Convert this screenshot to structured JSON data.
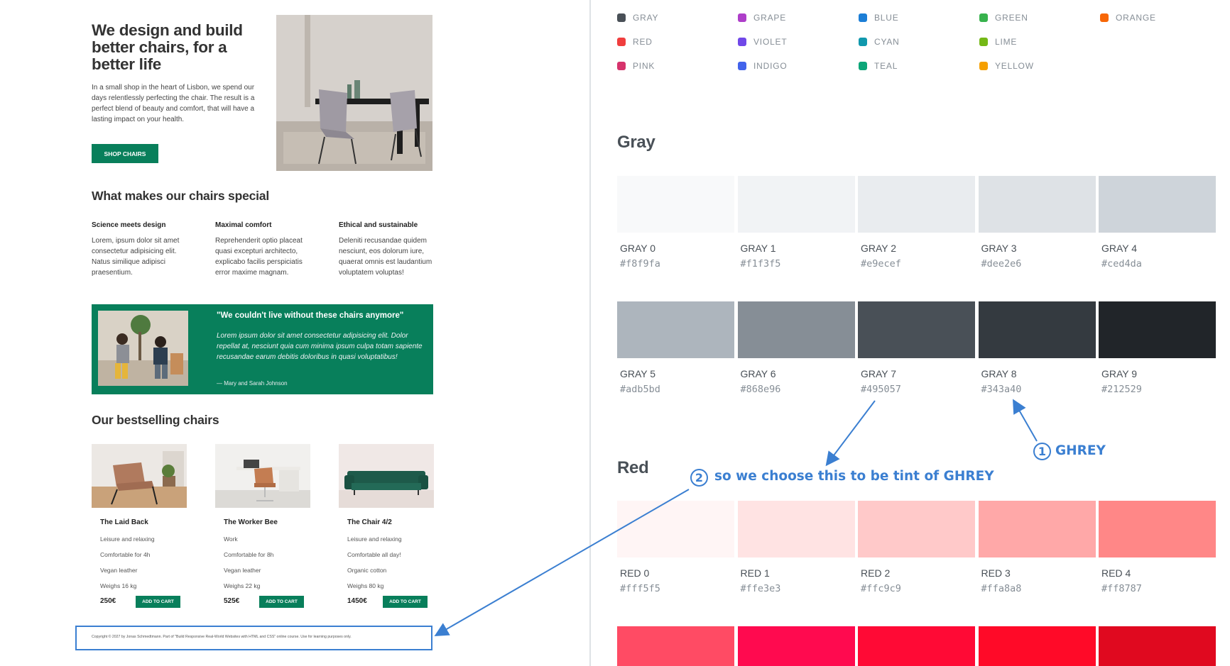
{
  "hero": {
    "title": "We design and build better chairs, for a better life",
    "text": "In a small shop in the heart of Lisbon, we spend our days relentlessly perfecting the chair. The result is a perfect blend of beauty and comfort, that will have a lasting impact on your health.",
    "button": "SHOP CHAIRS"
  },
  "features": {
    "title": "What makes our chairs special",
    "items": [
      {
        "title": "Science meets design",
        "text": "Lorem, ipsum dolor sit amet consectetur adipisicing elit. Natus similique adipisci praesentium."
      },
      {
        "title": "Maximal comfort",
        "text": "Reprehenderit optio placeat quasi excepturi architecto, explicabo facilis perspiciatis error maxime magnam."
      },
      {
        "title": "Ethical and sustainable",
        "text": "Deleniti recusandae quidem nesciunt, eos dolorum iure, quaerat omnis est laudantium voluptatem voluptas!"
      }
    ]
  },
  "testimonial": {
    "quote": "\"We couldn't live without these chairs anymore\"",
    "text": "Lorem ipsum dolor sit amet consectetur adipisicing elit. Dolor repellat at, nesciunt quia cum minima ipsum culpa totam sapiente recusandae earum debitis doloribus in quasi voluptatibus!",
    "author": "— Mary and Sarah Johnson"
  },
  "products": {
    "title": "Our bestselling chairs",
    "items": [
      {
        "name": "The Laid Back",
        "f1": "Leisure and relaxing",
        "f2": "Comfortable for 4h",
        "f3": "Vegan leather",
        "f4": "Weighs 16 kg",
        "price": "250€",
        "cart": "ADD TO CART"
      },
      {
        "name": "The Worker Bee",
        "f1": "Work",
        "f2": "Comfortable for 8h",
        "f3": "Vegan leather",
        "f4": "Weighs 22 kg",
        "price": "525€",
        "cart": "ADD TO CART"
      },
      {
        "name": "The Chair 4/2",
        "f1": "Leisure and relaxing",
        "f2": "Comfortable all day!",
        "f3": "Organic cotton",
        "f4": "Weighs 80 kg",
        "price": "1450€",
        "cart": "ADD TO CART"
      }
    ]
  },
  "footer": "Copyright © 2027 by Jonas Schmedtmann. Part of \"Build Responsive Real-World Websites with HTML and CSS\" online course. Use for learning purposes only.",
  "legend": [
    {
      "label": "GRAY",
      "color": "#495057"
    },
    {
      "label": "GRAPE",
      "color": "#ae3ec9"
    },
    {
      "label": "BLUE",
      "color": "#1c7ed6"
    },
    {
      "label": "GREEN",
      "color": "#37b24d"
    },
    {
      "label": "ORANGE",
      "color": "#f76707"
    },
    {
      "label": "RED",
      "color": "#f03e3e"
    },
    {
      "label": "VIOLET",
      "color": "#7048e8"
    },
    {
      "label": "CYAN",
      "color": "#1098ad"
    },
    {
      "label": "LIME",
      "color": "#74b816"
    },
    {
      "label": "PINK",
      "color": "#d6336c"
    },
    {
      "label": "INDIGO",
      "color": "#4263eb"
    },
    {
      "label": "TEAL",
      "color": "#0ca678"
    },
    {
      "label": "YELLOW",
      "color": "#f59f00"
    }
  ],
  "gray": {
    "heading": "Gray",
    "swatches": [
      {
        "name": "GRAY 0",
        "hex": "#f8f9fa"
      },
      {
        "name": "GRAY 1",
        "hex": "#f1f3f5"
      },
      {
        "name": "GRAY 2",
        "hex": "#e9ecef"
      },
      {
        "name": "GRAY 3",
        "hex": "#dee2e6"
      },
      {
        "name": "GRAY 4",
        "hex": "#ced4da"
      },
      {
        "name": "GRAY 5",
        "hex": "#adb5bd"
      },
      {
        "name": "GRAY 6",
        "hex": "#868e96"
      },
      {
        "name": "GRAY 7",
        "hex": "#495057"
      },
      {
        "name": "GRAY 8",
        "hex": "#343a40"
      },
      {
        "name": "GRAY 9",
        "hex": "#212529"
      }
    ]
  },
  "red": {
    "heading": "Red",
    "swatches": [
      {
        "name": "RED 0",
        "hex": "#fff5f5"
      },
      {
        "name": "RED 1",
        "hex": "#ffe3e3"
      },
      {
        "name": "RED 2",
        "hex": "#ffc9c9"
      },
      {
        "name": "RED 3",
        "hex": "#ffa8a8"
      },
      {
        "name": "RED 4",
        "hex": "#ff8787"
      }
    ],
    "row2_colors": [
      "#ff4b64",
      "#ff0a4f",
      "#ff0a35",
      "#ff0a28",
      "#e0091f"
    ]
  },
  "annotations": {
    "a1_num": "1",
    "a1_text": "GHREY",
    "a2_num": "2",
    "a2_text": "so we choose this to be tint of GHREY",
    "color": "#3b7fd1"
  }
}
